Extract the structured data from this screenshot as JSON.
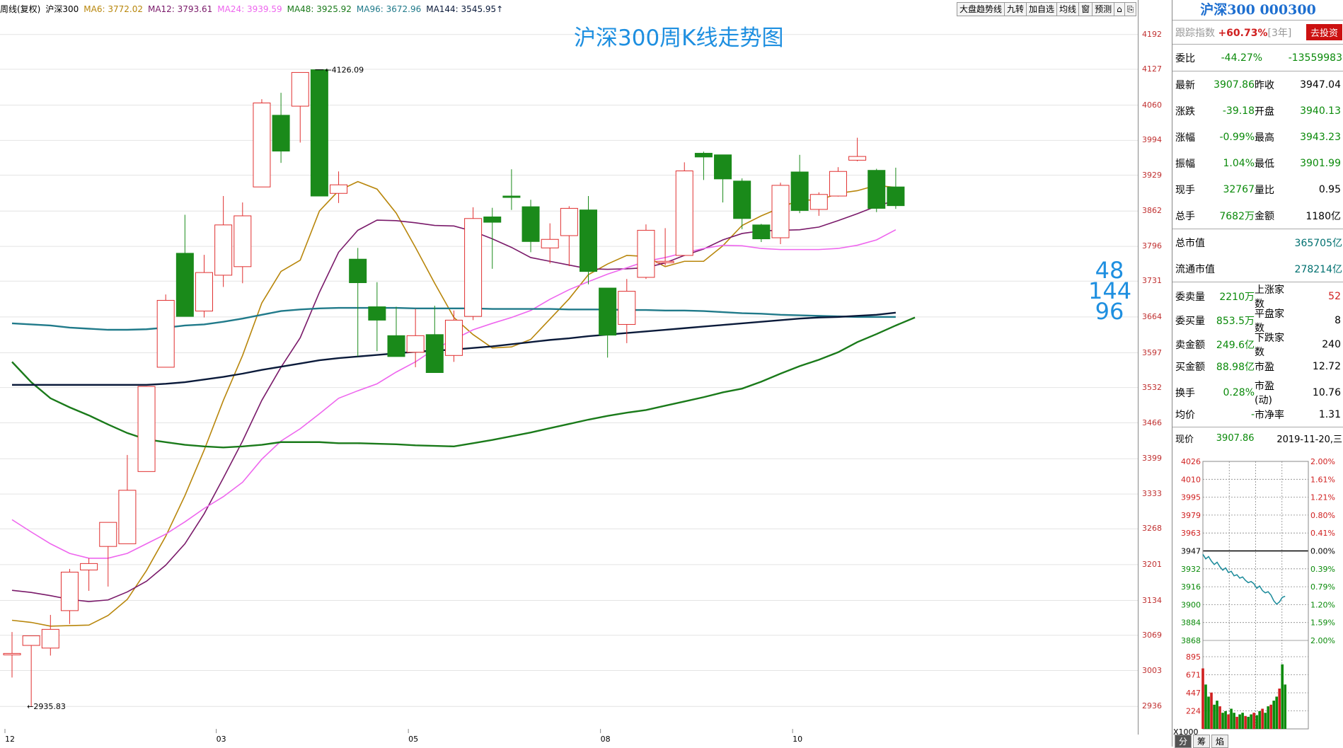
{
  "legend": {
    "title": "周线(复权)",
    "symbol": "沪深300",
    "items": [
      {
        "label": "MA6: 3772.02",
        "color": "#b8860b"
      },
      {
        "label": "MA12: 3793.61",
        "color": "#7a1a6a"
      },
      {
        "label": "MA24: 3939.59",
        "color": "#ee66ee"
      },
      {
        "label": "MA48: 3925.92",
        "color": "#1a7a1a"
      },
      {
        "label": "MA96: 3672.96",
        "color": "#207a8a"
      },
      {
        "label": "MA144: 3545.95",
        "color": "#0a1a3a"
      }
    ],
    "arrow": "↑"
  },
  "toolbar": [
    "大盘趋势线",
    "九转",
    "加自选",
    "均线",
    "窗",
    "预测",
    "⌂",
    "⎘"
  ],
  "chart_title": "沪深300周K线走势图",
  "ma_big_labels": [
    "48",
    "144",
    "96"
  ],
  "annotations": {
    "high_label": "4126.09",
    "low_label": "2935.83"
  },
  "chart_data": {
    "type": "candlestick",
    "yticks": [
      4192,
      4127,
      4060,
      3994,
      3929,
      3862,
      3796,
      3731,
      3664,
      3597,
      3532,
      3466,
      3399,
      3333,
      3268,
      3201,
      3134,
      3069,
      3003,
      2936
    ],
    "ylim": [
      2886,
      4230
    ],
    "xticks": [
      {
        "label": "12",
        "index": 0
      },
      {
        "label": "03",
        "index": 11
      },
      {
        "label": "05",
        "index": 21
      },
      {
        "label": "08",
        "index": 31
      },
      {
        "label": "10",
        "index": 41
      }
    ],
    "candles": [
      {
        "o": 3035,
        "c": 3035,
        "h": 3075,
        "l": 2990
      },
      {
        "o": 3050,
        "c": 3068,
        "h": 3068,
        "l": 2936
      },
      {
        "o": 3045,
        "c": 3080,
        "h": 3107,
        "l": 3031
      },
      {
        "o": 3115,
        "c": 3187,
        "h": 3193,
        "l": 3090
      },
      {
        "o": 3191,
        "c": 3203,
        "h": 3213,
        "l": 3152
      },
      {
        "o": 3235,
        "c": 3280,
        "h": 3280,
        "l": 3160
      },
      {
        "o": 3240,
        "c": 3340,
        "h": 3406,
        "l": 3240
      },
      {
        "o": 3375,
        "c": 3534,
        "h": 3534,
        "l": 3375
      },
      {
        "o": 3570,
        "c": 3695,
        "h": 3706,
        "l": 3570
      },
      {
        "o": 3783,
        "c": 3665,
        "h": 3855,
        "l": 3665
      },
      {
        "o": 3675,
        "c": 3747,
        "h": 3780,
        "l": 3663
      },
      {
        "o": 3742,
        "c": 3836,
        "h": 3890,
        "l": 3720
      },
      {
        "o": 3758,
        "c": 3853,
        "h": 3878,
        "l": 3727
      },
      {
        "o": 3907,
        "c": 4064,
        "h": 4071,
        "l": 3907
      },
      {
        "o": 4041,
        "c": 3974,
        "h": 4083,
        "l": 3952
      },
      {
        "o": 4058,
        "c": 4121,
        "h": 4121,
        "l": 3990
      },
      {
        "o": 4126,
        "c": 3890,
        "h": 4126,
        "l": 3890
      },
      {
        "o": 3895,
        "c": 3911,
        "h": 3936,
        "l": 3877
      },
      {
        "o": 3772,
        "c": 3728,
        "h": 3793,
        "l": 3590
      },
      {
        "o": 3683,
        "c": 3658,
        "h": 3729,
        "l": 3600
      },
      {
        "o": 3629,
        "c": 3590,
        "h": 3683,
        "l": 3590
      },
      {
        "o": 3598,
        "c": 3629,
        "h": 3679,
        "l": 3570
      },
      {
        "o": 3631,
        "c": 3560,
        "h": 3685,
        "l": 3560
      },
      {
        "o": 3592,
        "c": 3658,
        "h": 3676,
        "l": 3580
      },
      {
        "o": 3665,
        "c": 3848,
        "h": 3869,
        "l": 3658
      },
      {
        "o": 3851,
        "c": 3841,
        "h": 3868,
        "l": 3754
      },
      {
        "o": 3890,
        "c": 3889,
        "h": 3940,
        "l": 3864
      },
      {
        "o": 3870,
        "c": 3805,
        "h": 3883,
        "l": 3785
      },
      {
        "o": 3793,
        "c": 3809,
        "h": 3839,
        "l": 3764
      },
      {
        "o": 3816,
        "c": 3867,
        "h": 3871,
        "l": 3759
      },
      {
        "o": 3864,
        "c": 3749,
        "h": 3890,
        "l": 3725
      },
      {
        "o": 3718,
        "c": 3630,
        "h": 3718,
        "l": 3588
      },
      {
        "o": 3650,
        "c": 3712,
        "h": 3735,
        "l": 3615
      },
      {
        "o": 3738,
        "c": 3826,
        "h": 3837,
        "l": 3735
      },
      {
        "o": 3767,
        "c": 3768,
        "h": 3830,
        "l": 3760
      },
      {
        "o": 3779,
        "c": 3937,
        "h": 3953,
        "l": 3779
      },
      {
        "o": 3970,
        "c": 3963,
        "h": 3973,
        "l": 3920
      },
      {
        "o": 3967,
        "c": 3922,
        "h": 3967,
        "l": 3878
      },
      {
        "o": 3918,
        "c": 3848,
        "h": 3923,
        "l": 3828
      },
      {
        "o": 3836,
        "c": 3810,
        "h": 3838,
        "l": 3804
      },
      {
        "o": 3812,
        "c": 3910,
        "h": 3915,
        "l": 3800
      },
      {
        "o": 3935,
        "c": 3863,
        "h": 3967,
        "l": 3858
      },
      {
        "o": 3865,
        "c": 3893,
        "h": 3897,
        "l": 3853
      },
      {
        "o": 3890,
        "c": 3936,
        "h": 3944,
        "l": 3889
      },
      {
        "o": 3957,
        "c": 3964,
        "h": 3999,
        "l": 3955
      },
      {
        "o": 3938,
        "c": 3867,
        "h": 3941,
        "l": 3860
      },
      {
        "o": 3907,
        "c": 3872,
        "h": 3943,
        "l": 3866
      }
    ],
    "series": [
      {
        "name": "MA6",
        "color": "#b8860b",
        "values": [
          3097,
          3093,
          3086,
          3087,
          3088,
          3106,
          3136,
          3190,
          3254,
          3330,
          3415,
          3508,
          3592,
          3690,
          3749,
          3770,
          3862,
          3900,
          3917,
          3903,
          3858,
          3794,
          3727,
          3663,
          3631,
          3606,
          3608,
          3622,
          3660,
          3698,
          3743,
          3763,
          3779,
          3777,
          3758,
          3768,
          3768,
          3797,
          3835,
          3853,
          3868,
          3883,
          3882,
          3895,
          3900,
          3910,
          3906
        ]
      },
      {
        "name": "MA12",
        "color": "#7a1a6a",
        "values": [
          3153,
          3149,
          3143,
          3136,
          3132,
          3135,
          3150,
          3170,
          3200,
          3240,
          3296,
          3363,
          3432,
          3508,
          3570,
          3625,
          3710,
          3785,
          3826,
          3845,
          3844,
          3840,
          3835,
          3834,
          3824,
          3810,
          3794,
          3775,
          3768,
          3761,
          3754,
          3753,
          3754,
          3756,
          3765,
          3779,
          3791,
          3808,
          3820,
          3825,
          3826,
          3827,
          3832,
          3844,
          3857,
          3871,
          3882
        ]
      },
      {
        "name": "MA24",
        "color": "#ee66ee",
        "values": [
          3285,
          3262,
          3240,
          3222,
          3213,
          3213,
          3222,
          3240,
          3258,
          3281,
          3306,
          3328,
          3355,
          3398,
          3432,
          3455,
          3483,
          3512,
          3526,
          3539,
          3561,
          3580,
          3604,
          3622,
          3640,
          3652,
          3663,
          3676,
          3697,
          3715,
          3730,
          3744,
          3756,
          3768,
          3775,
          3784,
          3792,
          3798,
          3797,
          3792,
          3790,
          3790,
          3790,
          3792,
          3798,
          3808,
          3827
        ]
      },
      {
        "name": "MA48",
        "color": "#1a7a1a",
        "values": [
          3580,
          3542,
          3512,
          3495,
          3480,
          3463,
          3447,
          3435,
          3430,
          3425,
          3422,
          3420,
          3422,
          3425,
          3430,
          3430,
          3430,
          3428,
          3428,
          3427,
          3426,
          3424,
          3423,
          3422,
          3428,
          3434,
          3441,
          3448,
          3456,
          3464,
          3472,
          3479,
          3485,
          3490,
          3498,
          3506,
          3514,
          3523,
          3530,
          3543,
          3558,
          3572,
          3584,
          3598,
          3617,
          3632,
          3648,
          3663
        ]
      },
      {
        "name": "MA96",
        "color": "#207a8a",
        "values": [
          3652,
          3650,
          3648,
          3644,
          3642,
          3640,
          3640,
          3641,
          3644,
          3648,
          3650,
          3655,
          3661,
          3668,
          3675,
          3678,
          3680,
          3681,
          3681,
          3681,
          3681,
          3680,
          3680,
          3680,
          3680,
          3679,
          3679,
          3679,
          3679,
          3678,
          3678,
          3678,
          3677,
          3677,
          3676,
          3676,
          3675,
          3673,
          3671,
          3670,
          3668,
          3667,
          3666,
          3665,
          3664,
          3664,
          3664
        ]
      },
      {
        "name": "MA144",
        "color": "#0a1a3a",
        "values": [
          3537,
          3537,
          3537,
          3537,
          3537,
          3537,
          3537,
          3537,
          3539,
          3542,
          3547,
          3552,
          3558,
          3565,
          3571,
          3577,
          3583,
          3587,
          3590,
          3593,
          3596,
          3599,
          3601,
          3603,
          3606,
          3609,
          3613,
          3617,
          3621,
          3624,
          3628,
          3631,
          3634,
          3637,
          3640,
          3643,
          3646,
          3649,
          3652,
          3655,
          3658,
          3661,
          3663,
          3664,
          3666,
          3668,
          3672
        ]
      }
    ]
  },
  "panel": {
    "title": "沪深300 000300",
    "track": {
      "label": "跟踪指数",
      "value": "+60.73%",
      "term": "[3年]",
      "button": "去投资"
    },
    "weibi": {
      "label": "委比",
      "pct": "-44.27%",
      "val": "-13559983"
    },
    "quote": [
      {
        "l1": "最新",
        "v1": "3907.86",
        "l2": "昨收",
        "v2": "3947.04"
      },
      {
        "l1": "涨跌",
        "v1": "-39.18",
        "l2": "开盘",
        "v2": "3940.13"
      },
      {
        "l1": "涨幅",
        "v1": "-0.99%",
        "l2": "最高",
        "v2": "3943.23"
      },
      {
        "l1": "振幅",
        "v1": "1.04%",
        "l2": "最低",
        "v2": "3901.99"
      },
      {
        "l1": "现手",
        "v1": "32767",
        "l2": "量比",
        "v2": "0.95"
      },
      {
        "l1": "总手",
        "v1": "7682万",
        "l2": "金额",
        "v2": "1180亿"
      }
    ],
    "mcap": [
      {
        "label": "总市值",
        "value": "365705亿"
      },
      {
        "label": "流通市值",
        "value": "278214亿"
      }
    ],
    "stats": [
      {
        "l1": "委卖量",
        "v1": "2210万",
        "l2": "上涨家数",
        "v2": "52"
      },
      {
        "l1": "委买量",
        "v1": "853.5万",
        "l2": "平盘家数",
        "v2": "8"
      },
      {
        "l1": "卖金额",
        "v1": "249.6亿",
        "l2": "下跌家数",
        "v2": "240"
      },
      {
        "l1": "买金额",
        "v1": "88.98亿",
        "l2": "市盈",
        "v2": "12.72"
      },
      {
        "l1": "换手",
        "v1": "0.28%",
        "l2": "市盈(动)",
        "v2": "10.76"
      },
      {
        "l1": "均价",
        "v1": "-",
        "l2": "市净率",
        "v2": "1.31"
      }
    ],
    "now": {
      "label": "现价",
      "value": "3907.86",
      "date": "2019-11-20,三"
    },
    "mini_chart": {
      "left_ticks": [
        "4026",
        "4010",
        "3995",
        "3979",
        "3963",
        "3947",
        "3932",
        "3916",
        "3900",
        "3884",
        "3868"
      ],
      "right_ticks": [
        "2.00%",
        "1.61%",
        "1.21%",
        "0.80%",
        "0.41%",
        "0.00%",
        "0.39%",
        "0.79%",
        "1.20%",
        "1.59%",
        "2.00%"
      ],
      "vol_ticks": [
        "895",
        "671",
        "447",
        "224"
      ],
      "vol_unit": "X1000",
      "prev_close": 3947,
      "price_range": [
        3868,
        4026
      ],
      "prices": [
        3944,
        3940,
        3942,
        3938,
        3935,
        3937,
        3933,
        3930,
        3932,
        3928,
        3929,
        3925,
        3926,
        3923,
        3924,
        3921,
        3919,
        3920,
        3918,
        3914,
        3916,
        3912,
        3910,
        3911,
        3908,
        3903,
        3900,
        3902,
        3906,
        3907
      ],
      "volumes": [
        0.75,
        0.55,
        0.4,
        0.45,
        0.3,
        0.35,
        0.28,
        0.2,
        0.22,
        0.18,
        0.25,
        0.2,
        0.15,
        0.18,
        0.2,
        0.16,
        0.15,
        0.18,
        0.2,
        0.17,
        0.22,
        0.25,
        0.2,
        0.28,
        0.3,
        0.35,
        0.4,
        0.5,
        0.8,
        0.55
      ]
    },
    "tabs": [
      "分",
      "筹",
      "焰"
    ]
  }
}
